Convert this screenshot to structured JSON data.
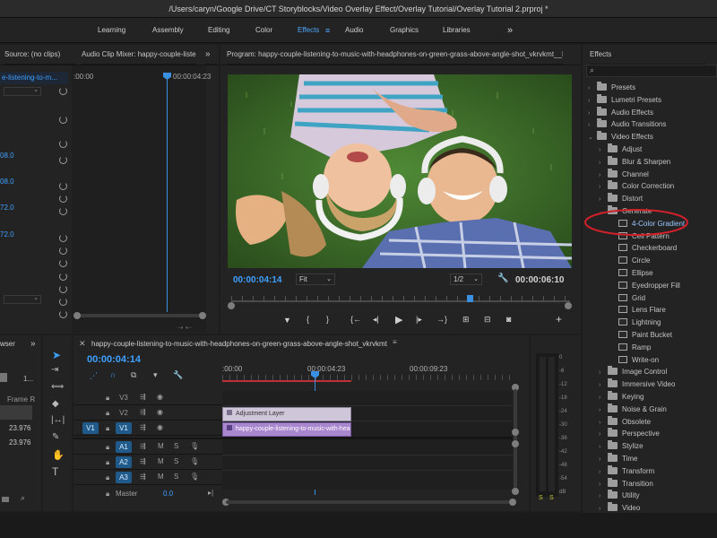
{
  "window_title": "/Users/caryn/Google Drive/CT Storyblocks/Video Overlay Effect/Overlay Tutorial/Overlay Tutorial 2.prproj *",
  "workspaces": [
    "Learning",
    "Assembly",
    "Editing",
    "Color",
    "Effects",
    "Audio",
    "Graphics",
    "Libraries"
  ],
  "active_workspace": "Effects",
  "workspace_more": "»",
  "left_panel": {
    "tab1": "Source: (no clips)",
    "tab2": "Audio Clip Mixer: happy-couple-liste",
    "tab_more": "»",
    "clip_label": "e-listening-to-m...",
    "ruler_start": ":00:00",
    "ruler_end": "00:00:04:23",
    "values": [
      "08.0",
      "08.0",
      "72.0",
      "72.0"
    ]
  },
  "program": {
    "title": "Program: happy-couple-listening-to-music-with-headphones-on-green-grass-above-angle-shot_vkrvkmt__D",
    "timecode": "00:00:04:14",
    "fit": "Fit",
    "quality": "1/2",
    "duration": "00:00:06:10"
  },
  "effects_panel": {
    "title": "Effects",
    "search_placeholder": "",
    "items": [
      {
        "label": "Presets",
        "level": 0,
        "open": false
      },
      {
        "label": "Lumetri Presets",
        "level": 0,
        "open": false
      },
      {
        "label": "Audio Effects",
        "level": 0,
        "open": false
      },
      {
        "label": "Audio Transitions",
        "level": 0,
        "open": false
      },
      {
        "label": "Video Effects",
        "level": 0,
        "open": true
      },
      {
        "label": "Adjust",
        "level": 1,
        "open": false
      },
      {
        "label": "Blur & Sharpen",
        "level": 1,
        "open": false
      },
      {
        "label": "Channel",
        "level": 1,
        "open": false
      },
      {
        "label": "Color Correction",
        "level": 1,
        "open": false
      },
      {
        "label": "Distort",
        "level": 1,
        "open": false
      },
      {
        "label": "Generate",
        "level": 1,
        "open": true
      },
      {
        "label": "4-Color Gradient",
        "level": 2,
        "effect": true,
        "highlight": true
      },
      {
        "label": "Cell Pattern",
        "level": 2,
        "effect": true
      },
      {
        "label": "Checkerboard",
        "level": 2,
        "effect": true
      },
      {
        "label": "Circle",
        "level": 2,
        "effect": true
      },
      {
        "label": "Ellipse",
        "level": 2,
        "effect": true
      },
      {
        "label": "Eyedropper Fill",
        "level": 2,
        "effect": true
      },
      {
        "label": "Grid",
        "level": 2,
        "effect": true
      },
      {
        "label": "Lens Flare",
        "level": 2,
        "effect": true
      },
      {
        "label": "Lightning",
        "level": 2,
        "effect": true
      },
      {
        "label": "Paint Bucket",
        "level": 2,
        "effect": true
      },
      {
        "label": "Ramp",
        "level": 2,
        "effect": true
      },
      {
        "label": "Write-on",
        "level": 2,
        "effect": true
      },
      {
        "label": "Image Control",
        "level": 1,
        "open": false
      },
      {
        "label": "Immersive Video",
        "level": 1,
        "open": false
      },
      {
        "label": "Keying",
        "level": 1,
        "open": false
      },
      {
        "label": "Noise & Grain",
        "level": 1,
        "open": false
      },
      {
        "label": "Obsolete",
        "level": 1,
        "open": false
      },
      {
        "label": "Perspective",
        "level": 1,
        "open": false
      },
      {
        "label": "Stylize",
        "level": 1,
        "open": false
      },
      {
        "label": "Time",
        "level": 1,
        "open": false
      },
      {
        "label": "Transform",
        "level": 1,
        "open": false
      },
      {
        "label": "Transition",
        "level": 1,
        "open": false
      },
      {
        "label": "Utility",
        "level": 1,
        "open": false
      },
      {
        "label": "Video",
        "level": 1,
        "open": false
      }
    ]
  },
  "project_panel": {
    "tab": "wser",
    "tab_more": "»",
    "number": "1...",
    "frame_header": "Frame R",
    "fps1": "23.976",
    "fps2": "23.976"
  },
  "timeline": {
    "title": "happy-couple-listening-to-music-with-headphones-on-green-grass-above-angle-shot_vkrvkmt__D",
    "timecode": "00:00:04:14",
    "ruler": [
      ":00:00",
      "00:00:04:23",
      "00:00:09:23"
    ],
    "video_tracks": [
      "V3",
      "V2",
      "V1"
    ],
    "source_target": "V1",
    "audio_tracks": [
      "A1",
      "A2",
      "A3"
    ],
    "master": "Master",
    "master_value": "0.0",
    "adjustment_clip": "Adjustment Layer",
    "video_clip": "happy-couple-listening-to-music-with-headph"
  },
  "audio_meter": {
    "labels": [
      "0",
      "-6",
      "-12",
      "-18",
      "-24",
      "-30",
      "-36",
      "-42",
      "-48",
      "-54",
      "dB"
    ],
    "s1": "S",
    "s2": "S"
  },
  "colors": {
    "accent": "#3ea0ff",
    "highlight_circle": "#d0202a",
    "adjustment_clip": "#cfc6d9",
    "video_clip": "#a987cf",
    "playhead": "#3a8fe0"
  }
}
